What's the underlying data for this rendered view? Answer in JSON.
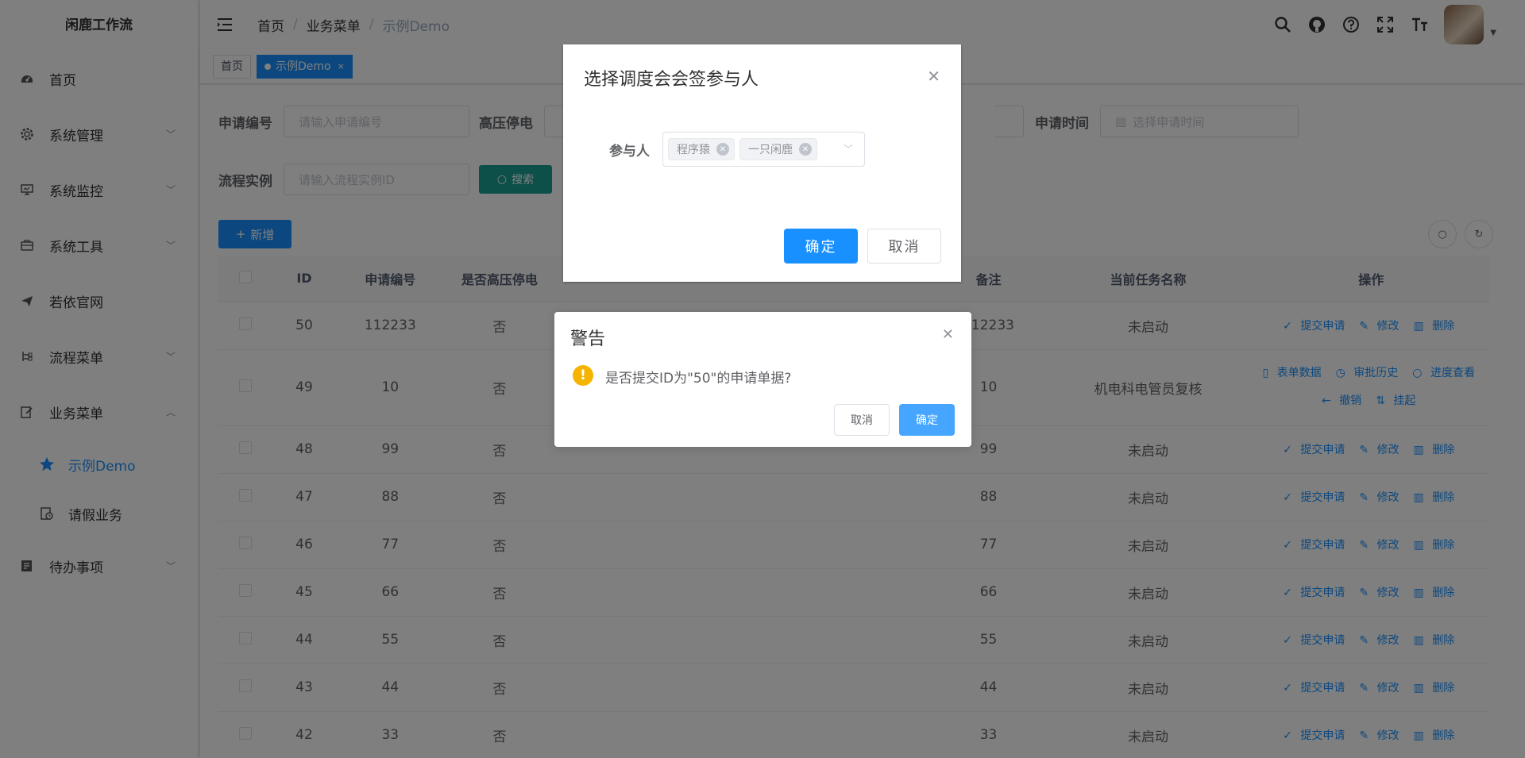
{
  "app": {
    "title": "闲鹿工作流"
  },
  "sidebar": {
    "items": [
      {
        "label": "首页",
        "icon": "dashboard-icon"
      },
      {
        "label": "系统管理",
        "icon": "gear-icon"
      },
      {
        "label": "系统监控",
        "icon": "monitor-icon"
      },
      {
        "label": "系统工具",
        "icon": "toolbox-icon"
      },
      {
        "label": "若依官网",
        "icon": "send-icon"
      },
      {
        "label": "流程菜单",
        "icon": "flow-icon"
      },
      {
        "label": "业务菜单",
        "icon": "edit-icon"
      }
    ],
    "sub_items": [
      {
        "label": "示例Demo",
        "icon": "star-icon",
        "active": true
      },
      {
        "label": "请假业务",
        "icon": "leave-icon"
      }
    ],
    "last_item": {
      "label": "待办事项",
      "icon": "todo-icon"
    }
  },
  "header": {
    "breadcrumb": [
      "首页",
      "业务菜单",
      "示例Demo"
    ],
    "separator": "/"
  },
  "tags": [
    {
      "label": "首页"
    },
    {
      "label": "示例Demo",
      "close": "×"
    }
  ],
  "search": {
    "apply_no_label": "申请编号",
    "apply_no_placeholder": "请输入申请编号",
    "hv_label": "高压停电",
    "apply_time_label": "申请时间",
    "apply_time_placeholder": "选择申请时间",
    "instance_label": "流程实例",
    "instance_placeholder": "请输入流程实例ID",
    "search_button": "搜索",
    "add_button": "新增"
  },
  "table": {
    "headers": {
      "id": "ID",
      "apply_no": "申请编号",
      "hv": "是否高压停电",
      "note": "备注",
      "task": "当前任务名称",
      "ops": "操作"
    },
    "ops_labels": {
      "submit": "提交申请",
      "edit": "修改",
      "delete": "删除",
      "form_data": "表单数据",
      "history": "审批历史",
      "progress": "进度查看",
      "revoke": "撤销",
      "suspend": "挂起"
    },
    "rows": [
      {
        "id": "50",
        "apply_no": "112233",
        "hv": "否",
        "note": "112233",
        "task": "未启动"
      },
      {
        "id": "49",
        "apply_no": "10",
        "hv": "否",
        "note": "10",
        "task": "机电科电管员复核"
      },
      {
        "id": "48",
        "apply_no": "99",
        "hv": "否",
        "note": "99",
        "task": "未启动"
      },
      {
        "id": "47",
        "apply_no": "88",
        "hv": "否",
        "note": "88",
        "task": "未启动"
      },
      {
        "id": "46",
        "apply_no": "77",
        "hv": "否",
        "note": "77",
        "task": "未启动"
      },
      {
        "id": "45",
        "apply_no": "66",
        "hv": "否",
        "note": "66",
        "task": "未启动"
      },
      {
        "id": "44",
        "apply_no": "55",
        "hv": "否",
        "note": "55",
        "task": "未启动"
      },
      {
        "id": "43",
        "apply_no": "44",
        "hv": "否",
        "note": "44",
        "task": "未启动"
      },
      {
        "id": "42",
        "apply_no": "33",
        "hv": "否",
        "note": "33",
        "task": "未启动"
      }
    ]
  },
  "dialog": {
    "title": "选择调度会会签参与人",
    "field_label": "参与人",
    "chips": [
      "程序猿",
      "一只闲鹿"
    ],
    "ok": "确定",
    "cancel": "取消"
  },
  "msgbox": {
    "title": "警告",
    "message": "是否提交ID为\"50\"的申请单据?",
    "cancel": "取消",
    "ok": "确定"
  },
  "colors": {
    "primary": "#1890ff",
    "warning": "#f5b400",
    "search_button": "#1aa094"
  }
}
